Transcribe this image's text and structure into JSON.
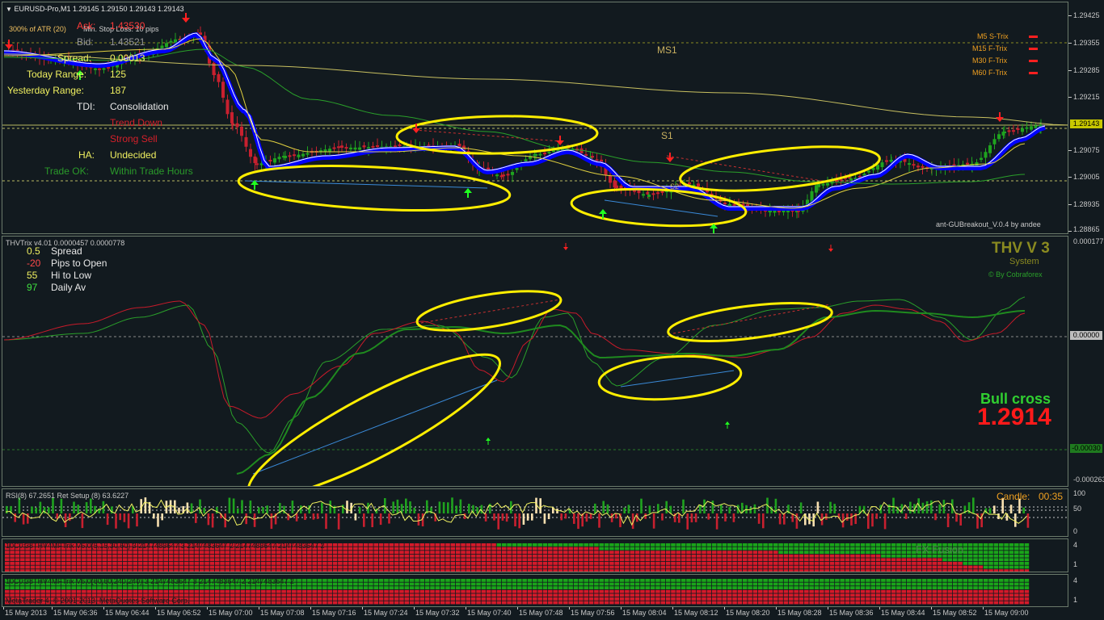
{
  "main": {
    "symbol_title": "EURUSD-Pro,M1  1.29145 1.29150 1.29143 1.29143",
    "atr_label": "300% of ATR (20)",
    "min_stop": "Min. Stop Loss:  10 pips",
    "ask_label": "Ask:",
    "ask_value": "1.43530",
    "bid_label": "Bid:",
    "bid_value": "1.43521",
    "spread_label": "Spread:",
    "spread_value": "0.00013",
    "today_range_label": "Today Range:",
    "today_range_value": "125",
    "yesterday_range_label": "Yesterday Range:",
    "yesterday_range_value": "187",
    "tdi_label": "TDI:",
    "tdi_value": "Consolidation",
    "trend_down": "Trend Down",
    "strong_sell": "Strong Sell",
    "ha_label": "HA:",
    "ha_value": "Undecided",
    "trade_ok_label": "Trade OK:",
    "trade_ok_value": "Within Trade Hours",
    "ms1": "MS1",
    "s1": "S1",
    "s2": "S2",
    "breakout_credit": "ant-GUBreakout_V.0.4 by andee",
    "trix_list": [
      "M5 S-Trix",
      "M15 F-Trix",
      "M30 F-Trix",
      "M60 F-Trix"
    ],
    "axis": [
      "1.29425",
      "1.29355",
      "1.29285",
      "1.29215",
      "1.29075",
      "1.29005",
      "1.28935",
      "1.28865"
    ],
    "current_price": "1.29143"
  },
  "thv": {
    "title": "THVTrix v4.01 0.0000457 0.0000778",
    "stats": [
      {
        "value": "0.5",
        "label": "Spread",
        "color": "#f0f060"
      },
      {
        "value": "-20",
        "label": "Pips to Open",
        "color": "#ff4a4a"
      },
      {
        "value": "55",
        "label": "Hi to Low",
        "color": "#f0f060"
      },
      {
        "value": "97",
        "label": "Daily Av",
        "color": "#40e040"
      }
    ],
    "brand": "THV V 3",
    "brand_sub": "System",
    "brand_credit": "© By Cobraforex",
    "bull_cross": "Bull cross",
    "bull_price": "1.2914",
    "axis_top": "0.0001778",
    "axis_zero": "0.00000",
    "axis_green": "-0.00030",
    "axis_bottom": "-0.000263"
  },
  "rsi": {
    "title": "RSI(8) 67.2651  Ret Setup (8) 63.6227",
    "candle_label": "Candle:",
    "candle_time": "00:35",
    "axis": [
      "100",
      "50",
      "0"
    ]
  },
  "mtf1": {
    "title": "10C0:38THV4MFTrix V6.0(5,15,30,60) 3 2147483647 3 2147483647 2 2147483647 2147483647 2",
    "watermark": "FX Fusion",
    "axis": [
      "4",
      "1"
    ]
  },
  "mtf2": {
    "title": "10C0:38THV4MFTrix V6.0(60,60,240,240) 3 2147483647 3 2147483647 2 2147483647 2",
    "copyright": "MetaTrader 4, © 2001-2013, MetaQuotes Software Corp.",
    "axis": [
      "4",
      "1"
    ]
  },
  "xaxis": [
    "15 May 2013",
    "15 May 06:36",
    "15 May 06:44",
    "15 May 06:52",
    "15 May 07:00",
    "15 May 07:08",
    "15 May 07:16",
    "15 May 07:24",
    "15 May 07:32",
    "15 May 07:40",
    "15 May 07:48",
    "15 May 07:56",
    "15 May 08:04",
    "15 May 08:12",
    "15 May 08:20",
    "15 May 08:28",
    "15 May 08:36",
    "15 May 08:44",
    "15 May 08:52",
    "15 May 09:00"
  ],
  "colors": {
    "bull": "#1fa31f",
    "bear": "#c8202f",
    "highlight": "#ffee00",
    "ma_blue": "#0000ff"
  }
}
